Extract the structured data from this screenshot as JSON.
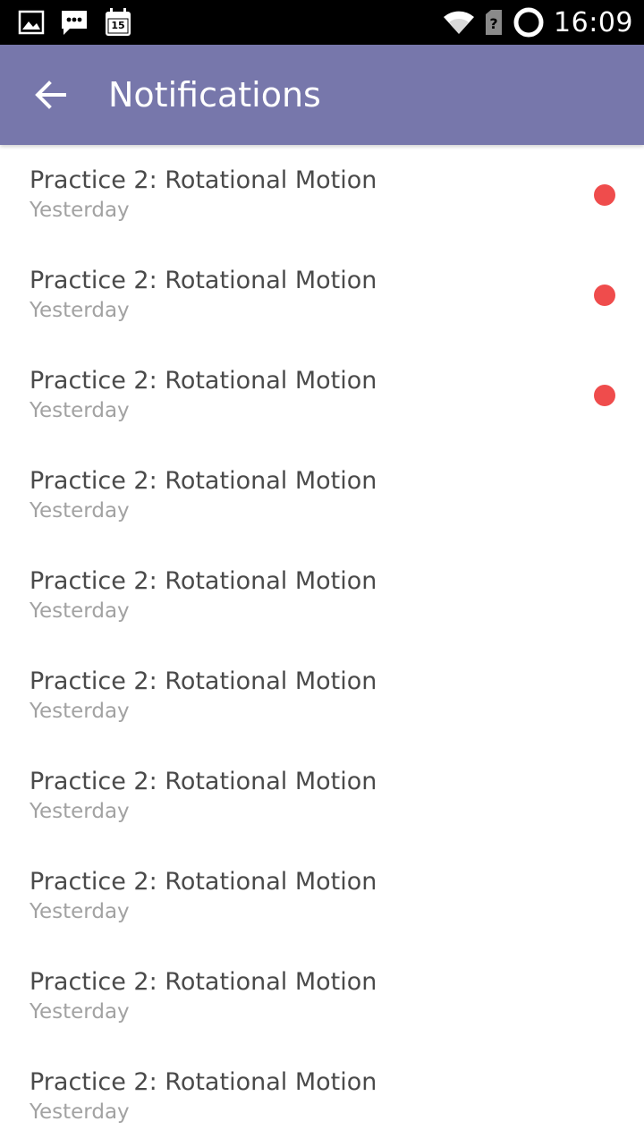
{
  "status_bar": {
    "icons_left": [
      "image-icon",
      "chat-icon",
      "calendar-icon"
    ],
    "calendar_badge": "15",
    "icons_right": [
      "wifi-icon",
      "no-sim-icon",
      "sync-icon"
    ],
    "time": "16:09"
  },
  "app_bar": {
    "back_icon": "arrow-back-icon",
    "title": "Notifications",
    "color": "#7777ab"
  },
  "notifications": [
    {
      "title": "Practice 2: Rotational Motion",
      "time": "Yesterday",
      "unread": true
    },
    {
      "title": "Practice 2: Rotational Motion",
      "time": "Yesterday",
      "unread": true
    },
    {
      "title": "Practice 2: Rotational Motion",
      "time": "Yesterday",
      "unread": true
    },
    {
      "title": "Practice 2: Rotational Motion",
      "time": "Yesterday",
      "unread": false
    },
    {
      "title": "Practice 2: Rotational Motion",
      "time": "Yesterday",
      "unread": false
    },
    {
      "title": "Practice 2: Rotational Motion",
      "time": "Yesterday",
      "unread": false
    },
    {
      "title": "Practice 2: Rotational Motion",
      "time": "Yesterday",
      "unread": false
    },
    {
      "title": "Practice 2: Rotational Motion",
      "time": "Yesterday",
      "unread": false
    },
    {
      "title": "Practice 2: Rotational Motion",
      "time": "Yesterday",
      "unread": false
    },
    {
      "title": "Practice 2: Rotational Motion",
      "time": "Yesterday",
      "unread": false
    }
  ],
  "colors": {
    "unread_dot": "#ef4c4c",
    "title_text": "#4a4a4a",
    "time_text": "#a2a2a2"
  }
}
